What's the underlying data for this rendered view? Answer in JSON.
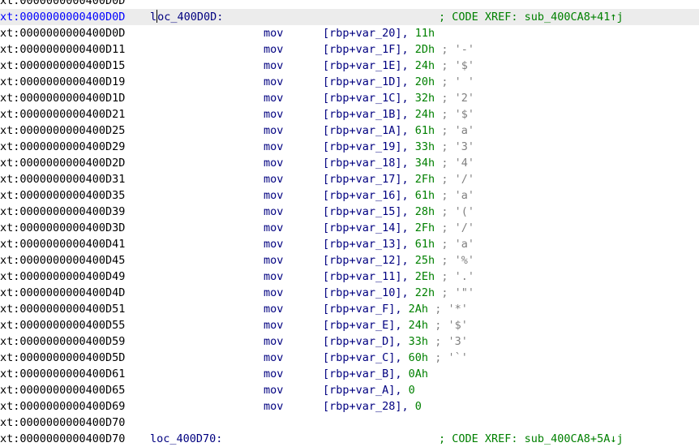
{
  "listing": {
    "lines": [
      {
        "kind": "plain",
        "address": "xt:0000000000400D0D"
      },
      {
        "kind": "label",
        "address": "xt:0000000000400D0D",
        "label_pre": "l",
        "label_post": "oc_400D0D:",
        "xref": "; CODE XREF: sub_400CA8+41↑j"
      },
      {
        "kind": "insn",
        "address": "xt:0000000000400D0D",
        "mnemonic": "mov",
        "operand": "[rbp+var_20], ",
        "imm": "11h",
        "comment": ""
      },
      {
        "kind": "insn",
        "address": "xt:0000000000400D11",
        "mnemonic": "mov",
        "operand": "[rbp+var_1F], ",
        "imm": "2Dh",
        "comment": " ; '-'"
      },
      {
        "kind": "insn",
        "address": "xt:0000000000400D15",
        "mnemonic": "mov",
        "operand": "[rbp+var_1E], ",
        "imm": "24h",
        "comment": " ; '$'"
      },
      {
        "kind": "insn",
        "address": "xt:0000000000400D19",
        "mnemonic": "mov",
        "operand": "[rbp+var_1D], ",
        "imm": "20h",
        "comment": " ; ' '"
      },
      {
        "kind": "insn",
        "address": "xt:0000000000400D1D",
        "mnemonic": "mov",
        "operand": "[rbp+var_1C], ",
        "imm": "32h",
        "comment": " ; '2'"
      },
      {
        "kind": "insn",
        "address": "xt:0000000000400D21",
        "mnemonic": "mov",
        "operand": "[rbp+var_1B], ",
        "imm": "24h",
        "comment": " ; '$'"
      },
      {
        "kind": "insn",
        "address": "xt:0000000000400D25",
        "mnemonic": "mov",
        "operand": "[rbp+var_1A], ",
        "imm": "61h",
        "comment": " ; 'a'"
      },
      {
        "kind": "insn",
        "address": "xt:0000000000400D29",
        "mnemonic": "mov",
        "operand": "[rbp+var_19], ",
        "imm": "33h",
        "comment": " ; '3'"
      },
      {
        "kind": "insn",
        "address": "xt:0000000000400D2D",
        "mnemonic": "mov",
        "operand": "[rbp+var_18], ",
        "imm": "34h",
        "comment": " ; '4'"
      },
      {
        "kind": "insn",
        "address": "xt:0000000000400D31",
        "mnemonic": "mov",
        "operand": "[rbp+var_17], ",
        "imm": "2Fh",
        "comment": " ; '/'"
      },
      {
        "kind": "insn",
        "address": "xt:0000000000400D35",
        "mnemonic": "mov",
        "operand": "[rbp+var_16], ",
        "imm": "61h",
        "comment": " ; 'a'"
      },
      {
        "kind": "insn",
        "address": "xt:0000000000400D39",
        "mnemonic": "mov",
        "operand": "[rbp+var_15], ",
        "imm": "28h",
        "comment": " ; '('"
      },
      {
        "kind": "insn",
        "address": "xt:0000000000400D3D",
        "mnemonic": "mov",
        "operand": "[rbp+var_14], ",
        "imm": "2Fh",
        "comment": " ; '/'"
      },
      {
        "kind": "insn",
        "address": "xt:0000000000400D41",
        "mnemonic": "mov",
        "operand": "[rbp+var_13], ",
        "imm": "61h",
        "comment": " ; 'a'"
      },
      {
        "kind": "insn",
        "address": "xt:0000000000400D45",
        "mnemonic": "mov",
        "operand": "[rbp+var_12], ",
        "imm": "25h",
        "comment": " ; '%'"
      },
      {
        "kind": "insn",
        "address": "xt:0000000000400D49",
        "mnemonic": "mov",
        "operand": "[rbp+var_11], ",
        "imm": "2Eh",
        "comment": " ; '.'"
      },
      {
        "kind": "insn",
        "address": "xt:0000000000400D4D",
        "mnemonic": "mov",
        "operand": "[rbp+var_10], ",
        "imm": "22h",
        "comment": " ; '\"'"
      },
      {
        "kind": "insn",
        "address": "xt:0000000000400D51",
        "mnemonic": "mov",
        "operand": "[rbp+var_F], ",
        "imm": "2Ah",
        "comment": " ; '*'"
      },
      {
        "kind": "insn",
        "address": "xt:0000000000400D55",
        "mnemonic": "mov",
        "operand": "[rbp+var_E], ",
        "imm": "24h",
        "comment": " ; '$'"
      },
      {
        "kind": "insn",
        "address": "xt:0000000000400D59",
        "mnemonic": "mov",
        "operand": "[rbp+var_D], ",
        "imm": "33h",
        "comment": " ; '3'"
      },
      {
        "kind": "insn",
        "address": "xt:0000000000400D5D",
        "mnemonic": "mov",
        "operand": "[rbp+var_C], ",
        "imm": "60h",
        "comment": " ; '`'"
      },
      {
        "kind": "insn",
        "address": "xt:0000000000400D61",
        "mnemonic": "mov",
        "operand": "[rbp+var_B], ",
        "imm": "0Ah",
        "comment": ""
      },
      {
        "kind": "insn",
        "address": "xt:0000000000400D65",
        "mnemonic": "mov",
        "operand": "[rbp+var_A], ",
        "imm": "0",
        "comment": ""
      },
      {
        "kind": "insn",
        "address": "xt:0000000000400D69",
        "mnemonic": "mov",
        "operand": "[rbp+var_28], ",
        "imm": "0",
        "comment": ""
      },
      {
        "kind": "plain",
        "address": "xt:0000000000400D70"
      },
      {
        "kind": "label",
        "address": "xt:0000000000400D70",
        "label_pre": "",
        "label_post": "loc_400D70:",
        "xref": "; CODE XREF: sub_400CA8+5A↓j"
      }
    ]
  },
  "colors": {
    "address": "#000000",
    "selected_address": "#0000ff",
    "selected_line_bg": "#ececec",
    "mnemonic": "#000080",
    "operand": "#000080",
    "immediate": "#008000",
    "comment": "#808080",
    "xref_comment": "#008000"
  }
}
